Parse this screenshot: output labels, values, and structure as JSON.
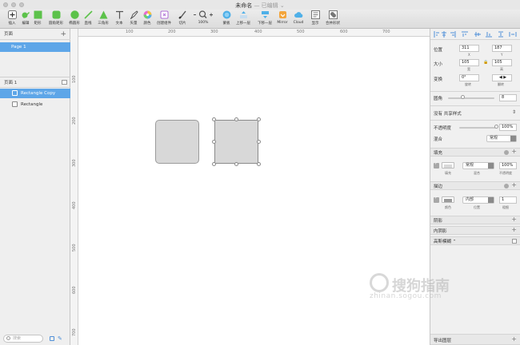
{
  "window": {
    "title": "未命名",
    "subtitle": "— 已编辑 ⌄"
  },
  "toolbar": {
    "items": [
      {
        "label": "插入",
        "icon": "plus-icon"
      },
      {
        "label": "编辑",
        "icon": "pen-icon"
      },
      {
        "label": "矩形",
        "icon": "rectangle-icon"
      },
      {
        "label": "圆角矩形",
        "icon": "rounded-rect-icon"
      },
      {
        "label": "椭圆形",
        "icon": "oval-icon"
      },
      {
        "label": "直线",
        "icon": "line-icon"
      },
      {
        "label": "三角形",
        "icon": "triangle-icon"
      },
      {
        "label": "文本",
        "icon": "text-icon"
      },
      {
        "label": "矢量",
        "icon": "vector-icon"
      },
      {
        "label": "颜色",
        "icon": "color-wheel-icon"
      },
      {
        "label": "创建组件",
        "icon": "symbol-icon"
      },
      {
        "label": "切片",
        "icon": "slice-icon"
      },
      {
        "label": "100%",
        "icon": "zoom-icon"
      },
      {
        "label": "蒙板",
        "icon": "mask-icon"
      },
      {
        "label": "上移一层",
        "icon": "forward-icon"
      },
      {
        "label": "下移一层",
        "icon": "backward-icon"
      },
      {
        "label": "Mirror",
        "icon": "mirror-icon"
      },
      {
        "label": "Cloud",
        "icon": "cloud-icon"
      },
      {
        "label": "显示",
        "icon": "view-icon"
      },
      {
        "label": "合并形状",
        "icon": "union-icon"
      }
    ]
  },
  "colors": {
    "accent": "#5ea6e8",
    "toolbar_green": "#5cc24a",
    "shape_fill": "#d8d8d8",
    "shape_border": "#9b9b9b"
  },
  "pages_panel": {
    "title": "页面",
    "pages": [
      {
        "label": "Page 1",
        "selected": true
      }
    ]
  },
  "layers_panel": {
    "title": "页面 1",
    "layers": [
      {
        "label": "Rectangle Copy",
        "selected": true
      },
      {
        "label": "Rectangle",
        "selected": false
      }
    ],
    "search_placeholder": "搜索"
  },
  "ruler": {
    "top": [
      "100",
      "200",
      "300",
      "400",
      "500",
      "600",
      "700"
    ],
    "left": [
      "100",
      "200",
      "300",
      "400",
      "500",
      "600",
      "700"
    ]
  },
  "inspector": {
    "position": {
      "label": "位置",
      "x": "311",
      "y": "187",
      "x_sub": "X",
      "y_sub": "Y"
    },
    "size": {
      "label": "大小",
      "w": "105",
      "h": "105",
      "w_sub": "宽",
      "h_sub": "高"
    },
    "transform": {
      "label": "变换",
      "rotate": "0°",
      "rotate_sub": "旋转",
      "flip_sub": "翻转"
    },
    "radius": {
      "label": "圆角",
      "value": "8"
    },
    "shared_style": "没有 共享样式",
    "opacity": {
      "label": "不透明度",
      "value": "100%"
    },
    "blending": {
      "label": "混合",
      "value": "常规"
    },
    "fills": {
      "title": "填充",
      "mode": "常规",
      "opacity": "100%",
      "sub_fill": "填充",
      "sub_blend": "混合",
      "sub_opacity": "不透明度"
    },
    "borders": {
      "title": "描边",
      "position": "内部",
      "thickness": "1",
      "sub_color": "颜色",
      "sub_position": "位置",
      "sub_thickness": "粗细"
    },
    "shadows": "阴影",
    "inner_shadows": "内阴影",
    "gaussian_blur": "高斯模糊 ⌃",
    "export": "导出图层"
  },
  "watermark": {
    "text": "搜狗指南",
    "url": "zhinan.sogou.com"
  }
}
